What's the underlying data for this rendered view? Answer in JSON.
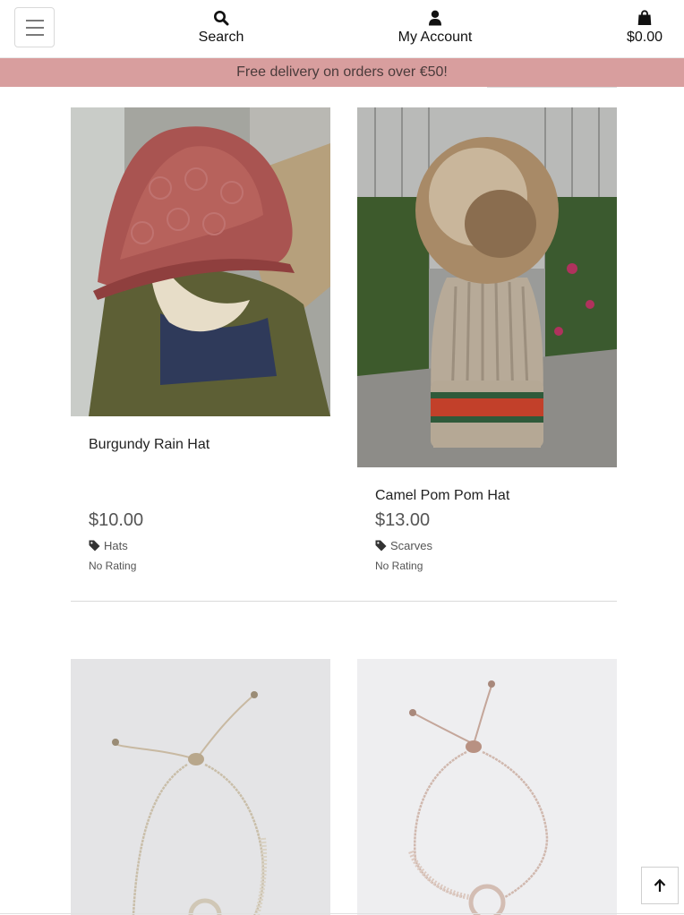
{
  "header": {
    "menu_icon": "hamburger-icon",
    "search_label": "Search",
    "search_icon": "search-icon",
    "account_label": "My Account",
    "account_icon": "user-icon",
    "bag_total": "$0.00",
    "bag_icon": "shopping-bag-icon"
  },
  "banner": {
    "text": "Free delivery on orders over €50!",
    "color": "#d89e9e"
  },
  "products": [
    {
      "title": "Burgundy Rain Hat",
      "price": "$10.00",
      "category": "Hats",
      "rating": "No Rating",
      "image": "burgundy quilted bucket hat photo"
    },
    {
      "title": "Camel Pom Pom Hat",
      "price": "$13.00",
      "category": "Scarves",
      "rating": "No Rating",
      "image": "camel ribbed beanie with fur pom pom photo"
    },
    {
      "title": "",
      "price": "",
      "category": "",
      "rating": "",
      "image": "silver slider bracelet photo"
    },
    {
      "title": "",
      "price": "",
      "category": "",
      "rating": "",
      "image": "rose gold circle slider bracelet photo"
    }
  ],
  "back_to_top_icon": "arrow-up-icon"
}
